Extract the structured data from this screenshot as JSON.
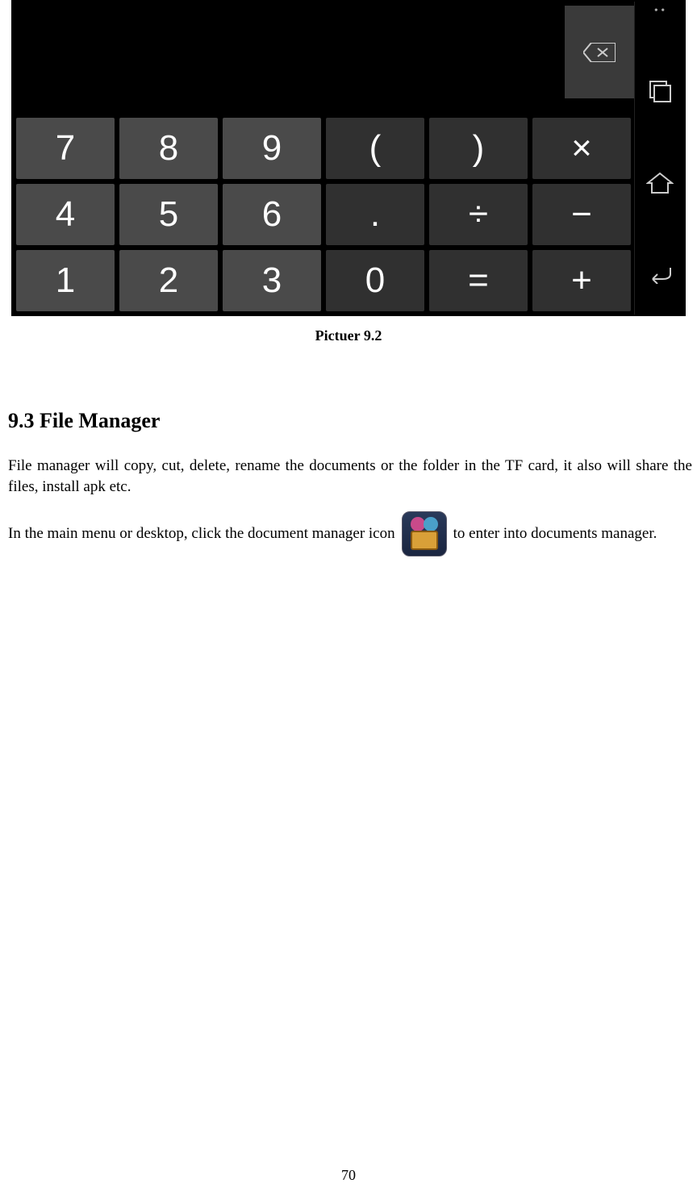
{
  "calculator": {
    "keys_row1": [
      "7",
      "8",
      "9",
      "(",
      ")",
      "×"
    ],
    "keys_row2": [
      "4",
      "5",
      "6",
      ".",
      "÷",
      "−"
    ],
    "keys_row3": [
      "1",
      "2",
      "3",
      "0",
      "=",
      "+"
    ]
  },
  "caption": "Pictuer 9.2",
  "section": {
    "heading": "9.3 File Manager",
    "para1": "File manager will copy, cut, delete, rename the documents or the folder in the TF card, it also will share the files, install apk etc.",
    "para2_before": "In the main menu or desktop, click the document manager icon",
    "para2_after": "to enter into documents manager."
  },
  "page_number": "70"
}
